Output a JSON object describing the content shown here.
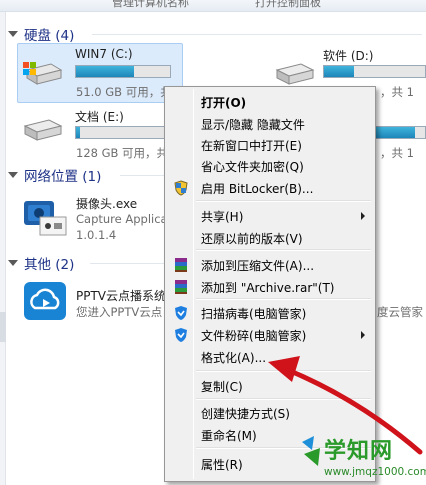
{
  "top_bar": {
    "items": [
      "管理计算机名称",
      "打开控制面板"
    ]
  },
  "groups": {
    "hard_disks": {
      "header": "硬盘 (4)"
    },
    "network": {
      "header": "网络位置 (1)"
    },
    "other": {
      "header": "其他 (2)"
    }
  },
  "drives": [
    {
      "name": "WIN7 (C:)",
      "free_text": "51.0 GB 可用，共 1",
      "used_fraction": 0.62,
      "selected": true
    },
    {
      "name": "软件 (D:)",
      "free_text": "，共 1",
      "used_fraction": 0.3,
      "selected": false
    },
    {
      "name": "文档 (E:)",
      "free_text": "128 GB 可用，共 1",
      "used_fraction": 0.04,
      "selected": false
    },
    {
      "name": "",
      "free_text": "，共 1",
      "used_fraction": 0.9,
      "selected": false
    }
  ],
  "network_item": {
    "title": "摄像头.exe",
    "subtitle": "Capture Applica",
    "version": "1.0.1.4"
  },
  "other_items": [
    {
      "title": "PPTV云点播系统",
      "subtitle": "您进入PPTV云点"
    },
    {
      "title": "",
      "subtitle": "度云管家"
    }
  ],
  "context_menu": {
    "items": [
      {
        "label": "打开(O)",
        "bold": true,
        "icon": null,
        "submenu": false
      },
      {
        "label": "显示/隐藏 隐藏文件",
        "bold": false,
        "icon": null,
        "submenu": false
      },
      {
        "label": "在新窗口中打开(E)",
        "bold": false,
        "icon": null,
        "submenu": false
      },
      {
        "label": "省心文件夹加密(Q)",
        "bold": false,
        "icon": null,
        "submenu": false
      },
      {
        "label": "启用 BitLocker(B)...",
        "bold": false,
        "icon": "uac-shield-icon",
        "submenu": false
      },
      {
        "separator": true
      },
      {
        "label": "共享(H)",
        "bold": false,
        "icon": null,
        "submenu": true
      },
      {
        "label": "还原以前的版本(V)",
        "bold": false,
        "icon": null,
        "submenu": false
      },
      {
        "separator": true
      },
      {
        "label": "添加到压缩文件(A)...",
        "bold": false,
        "icon": "winrar-icon",
        "submenu": false
      },
      {
        "label": "添加到 \"Archive.rar\"(T)",
        "bold": false,
        "icon": "winrar-icon",
        "submenu": false
      },
      {
        "separator": true
      },
      {
        "label": "扫描病毒(电脑管家)",
        "bold": false,
        "icon": "tencent-shield-icon",
        "submenu": false
      },
      {
        "label": "文件粉碎(电脑管家)",
        "bold": false,
        "icon": "tencent-shield-icon",
        "submenu": true
      },
      {
        "label": "格式化(A)...",
        "bold": false,
        "icon": null,
        "submenu": false
      },
      {
        "separator": true
      },
      {
        "label": "复制(C)",
        "bold": false,
        "icon": null,
        "submenu": false
      },
      {
        "separator": true
      },
      {
        "label": "创建快捷方式(S)",
        "bold": false,
        "icon": null,
        "submenu": false
      },
      {
        "label": "重命名(M)",
        "bold": false,
        "icon": null,
        "submenu": false
      },
      {
        "separator": true
      },
      {
        "label": "属性(R)",
        "bold": false,
        "icon": null,
        "submenu": false
      }
    ]
  },
  "watermark": {
    "title": "学知网",
    "url": "www.jmqz1000.com"
  },
  "colors": {
    "annotation_arrow": "#d0121b",
    "group_header": "#1e3287",
    "drive_bar": "#2a9fd0",
    "watermark": "#2a9a2a"
  }
}
